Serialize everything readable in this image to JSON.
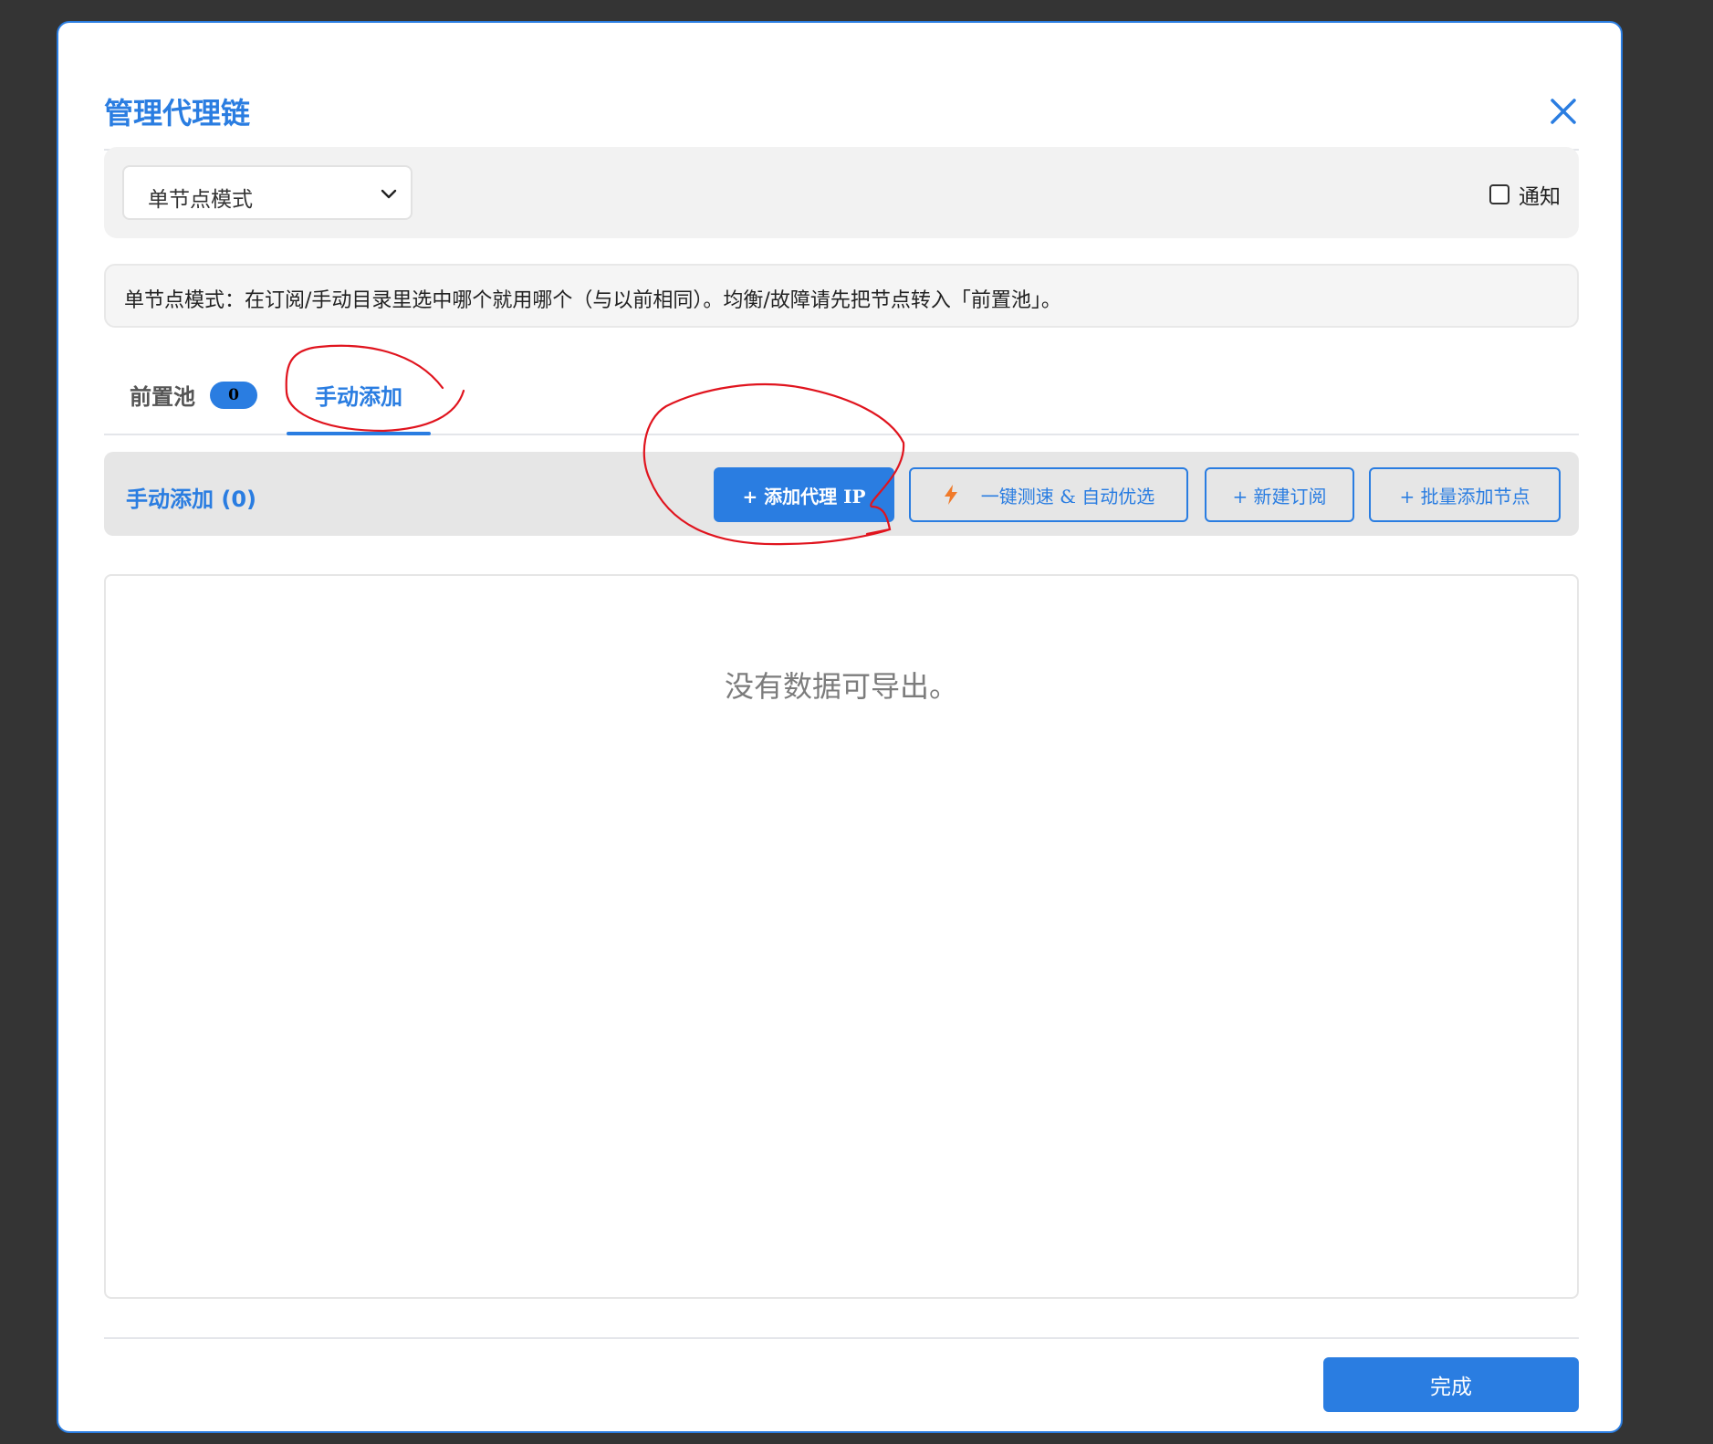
{
  "modal": {
    "title": "管理代理链"
  },
  "mode_select": {
    "value": "单节点模式"
  },
  "notify": {
    "label": "通知",
    "checked": false
  },
  "info": {
    "text": "单节点模式：在订阅/手动目录里选中哪个就用哪个（与以前相同）。均衡/故障请先把节点转入「前置池」。"
  },
  "tabs": {
    "pool_label": "前置池",
    "pool_count": "0",
    "manual_label": "手动添加",
    "active": "manual"
  },
  "toolbar": {
    "title": "手动添加 (0)",
    "add_ip": "+ 添加代理 IP",
    "speed_test": "一键测速 & 自动优选",
    "new_subscription": "+ 新建订阅",
    "batch_add": "+ 批量添加节点"
  },
  "content": {
    "empty_text": "没有数据可导出。"
  },
  "footer": {
    "done": "完成"
  },
  "colors": {
    "accent": "#2a7de1",
    "annotation": "#e0141e",
    "bolt": "#f07a2a"
  }
}
